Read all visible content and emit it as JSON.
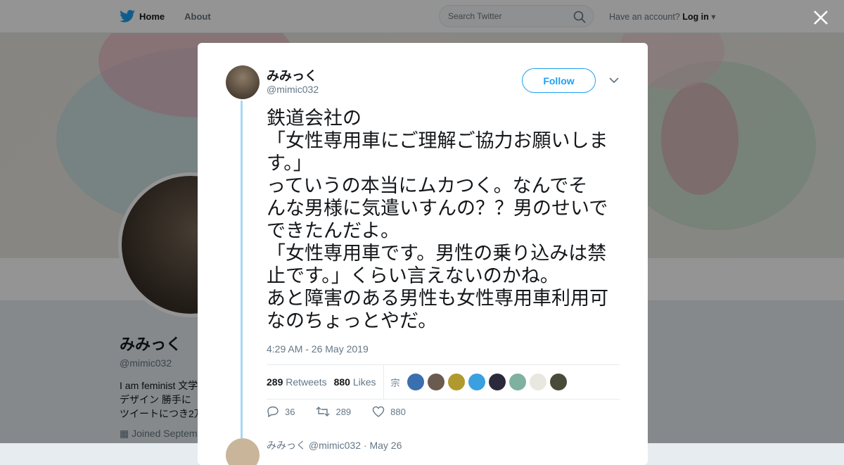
{
  "nav": {
    "home_label": "Home",
    "about_label": "About",
    "search_placeholder": "Search Twitter",
    "account_prompt": "Have an account?",
    "login_label": "Log in"
  },
  "profile": {
    "name": "みみっく",
    "handle": "@mimic032",
    "bio_line1": "I am feminist 文学",
    "bio_line2": "デザイン 勝手に",
    "bio_line3": "ツイートにつき2万",
    "joined": "Joined Septem"
  },
  "tweet": {
    "fullname": "みみっく",
    "handle": "@mimic032",
    "follow_label": "Follow",
    "text": "鉄道会社の\n「女性専用車にご理解ご協力お願いしま\nす。」\nっていうの本当にムカつく。なんでそ\nんな男様に気遣いすんの？？男のせいで\nできたんだよ。\n「女性専用車です。男性の乗り込みは禁\n止です。」くらい言えないのかね。\nあと障害のある男性も女性専用車利用可\nなのちょっとやだ。",
    "timestamp": "4:29 AM - 26 May 2019",
    "retweets_count": "289",
    "retweets_label": "Retweets",
    "likes_count": "880",
    "likes_label": "Likes",
    "likers_glyph": "宗",
    "liker_colors": [
      "#3a6fb0",
      "#6b5a4e",
      "#b09a2e",
      "#3aa0e0",
      "#2a2a3a",
      "#7fb0a0",
      "#e8e8e0",
      "#4a4a3a"
    ],
    "reply_count": "36",
    "retweet_count": "289",
    "like_count": "880",
    "reply_preview": "みみっく @mimic032 · May 26"
  },
  "colors": {
    "accent": "#1da1f2",
    "thread_line": "#a6d8f8"
  }
}
